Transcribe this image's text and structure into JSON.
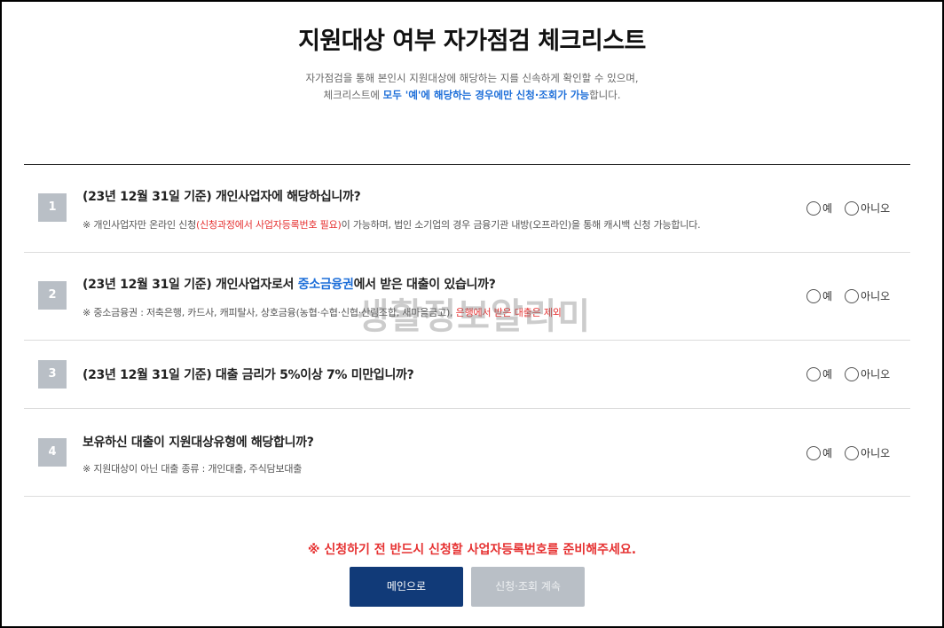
{
  "header": {
    "title": "지원대상 여부 자가점검 체크리스트",
    "desc_line1": "자가점검을 통해 본인시 지원대상에 해당하는 지를 신속하게 확인할 수 있으며,",
    "desc_line2_a": "체크리스트에 ",
    "desc_line2_hl": "모두 '예'에 해당하는 경우에만 신청·조회가 가능",
    "desc_line2_b": "합니다."
  },
  "questions": [
    {
      "num": "1",
      "q_a": "(23년 12월 31일 기준) 개인사업자에 해당하십니까?",
      "q_hl": "",
      "q_b": "",
      "note_a": "※ 개인사업자만 온라인 신청",
      "note_red": "(신청과정에서 사업자등록번호 필요)",
      "note_b": "이 가능하며, 법인 소기업의 경우 금융기관 내방(오프라인)을 통해 캐시백 신청 가능합니다."
    },
    {
      "num": "2",
      "q_a": "(23년 12월 31일 기준) 개인사업자로서 ",
      "q_hl": "중소금융권",
      "q_b": "에서 받은 대출이 있습니까?",
      "note_a": "※ 중소금융권 : 저축은행, 카드사, 캐피탈사, 상호금융(농협·수협·신협·산림조합, 새마을금고), ",
      "note_red": "은행에서 받은 대출은 제외",
      "note_b": ""
    },
    {
      "num": "3",
      "q_a": "(23년 12월 31일 기준) 대출 금리가 5%이상 7% 미만입니까?",
      "q_hl": "",
      "q_b": "",
      "note_a": "",
      "note_red": "",
      "note_b": ""
    },
    {
      "num": "4",
      "q_a": "보유하신 대출이 지원대상유형에 해당합니까?",
      "q_hl": "",
      "q_b": "",
      "note_a": "※ 지원대상이 아닌 대출 종류 : 개인대출, 주식담보대출",
      "note_red": "",
      "note_b": ""
    }
  ],
  "options": {
    "yes": "예",
    "no": "아니오"
  },
  "footer": {
    "warning": "※ 신청하기 전 반드시 신청할 사업자등록번호를 준비해주세요.",
    "main_button": "메인으로",
    "continue_button": "신청·조회 계속"
  },
  "watermark": "생활정보알리미"
}
